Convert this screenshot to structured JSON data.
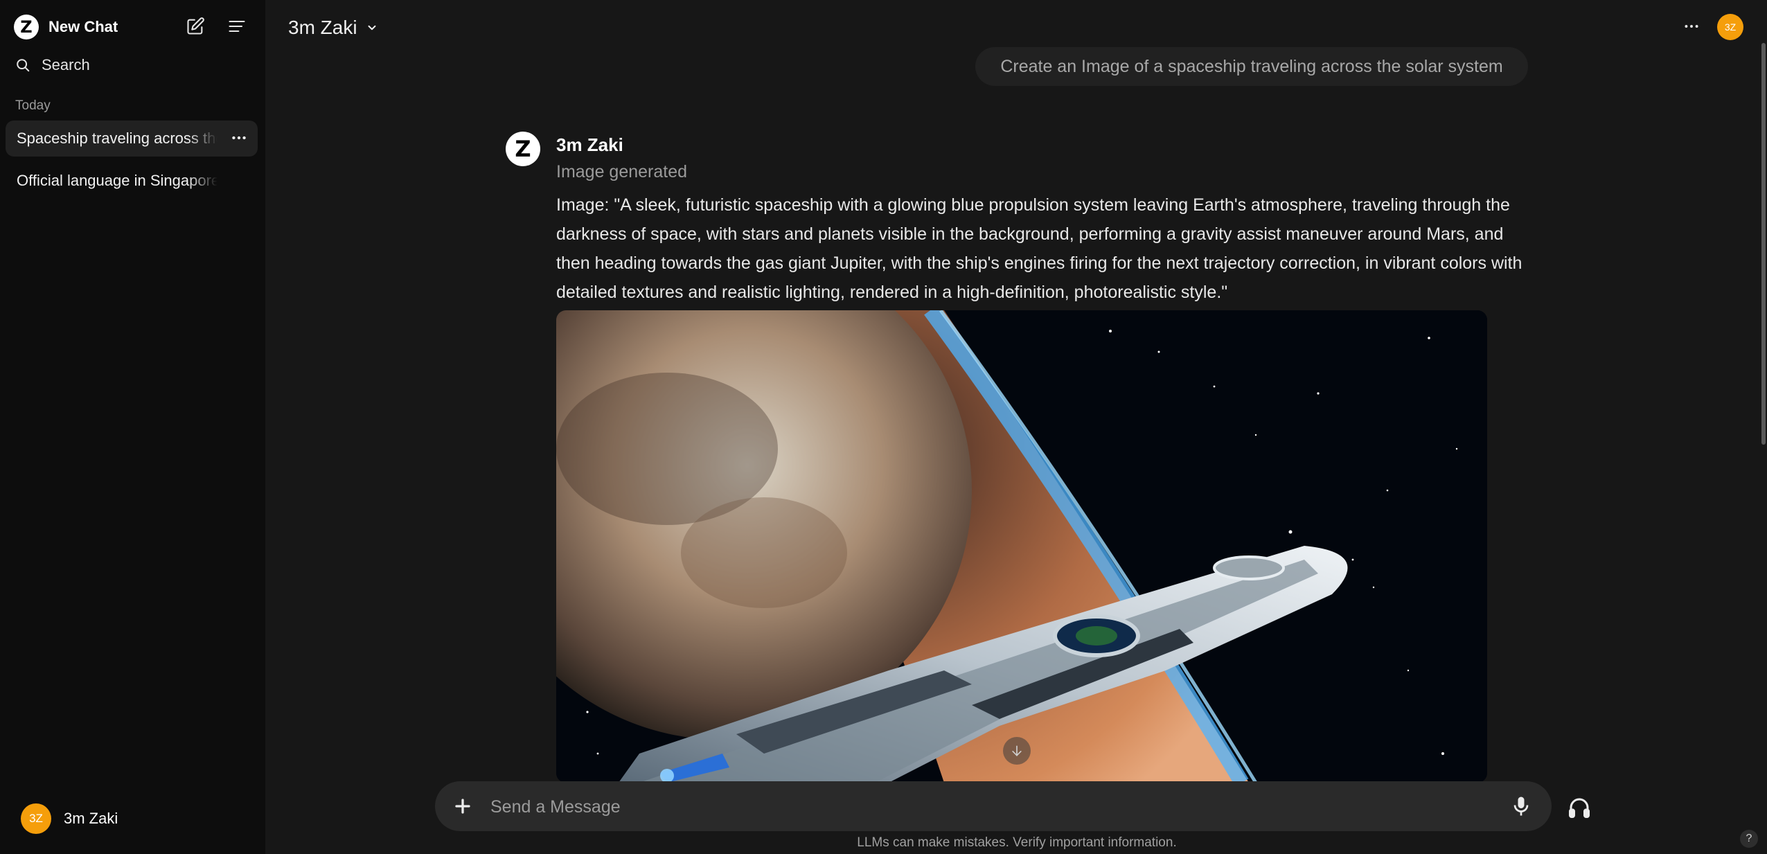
{
  "sidebar": {
    "logo_letter": "Z",
    "new_chat_label": "New Chat",
    "search_label": "Search",
    "section_label": "Today",
    "items": [
      {
        "label": "Spaceship traveling across the solar system",
        "active": true
      },
      {
        "label": "Official language in Singapore",
        "active": false
      }
    ],
    "user": {
      "initials": "3Z",
      "name": "3m Zaki"
    }
  },
  "header": {
    "model_name": "3m Zaki",
    "avatar_initials": "3Z"
  },
  "conversation": {
    "user_message": "Create an Image of a spaceship traveling across the solar system",
    "assistant": {
      "logo_letter": "Z",
      "name": "3m Zaki",
      "status": "Image generated",
      "text": "Image: \"A sleek, futuristic spaceship with a glowing blue propulsion system leaving Earth's atmosphere, traveling through the darkness of space, with stars and planets visible in the background, performing a gravity assist maneuver around Mars, and then heading towards the gas giant Jupiter, with the ship's engines firing for the next trajectory correction, in vibrant colors with detailed textures and realistic lighting, rendered in a high-definition, photorealistic style.\""
    }
  },
  "composer": {
    "placeholder": "Send a Message",
    "disclaimer": "LLMs can make mistakes. Verify important information."
  },
  "help_label": "?",
  "colors": {
    "accent_avatar": "#f59e0b",
    "sidebar_bg": "#0d0d0d",
    "main_bg": "#171717"
  }
}
